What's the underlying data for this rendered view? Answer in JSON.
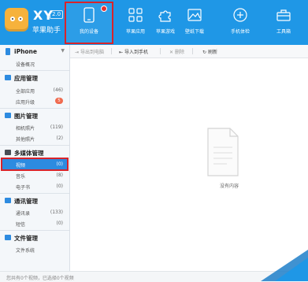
{
  "brand": {
    "logo_text": "XY",
    "version": "2.0",
    "subtitle": "苹果助手"
  },
  "nav": [
    {
      "label": "我的设备",
      "icon": "phone-icon",
      "active": true
    },
    {
      "label": "苹果应用",
      "icon": "apps-grid-icon"
    },
    {
      "label": "苹果游戏",
      "icon": "puzzle-icon"
    },
    {
      "label": "壁纸下载",
      "icon": "image-icon"
    },
    {
      "label": "手机体检",
      "icon": "plus-circle-icon"
    },
    {
      "label": "工具箱",
      "icon": "toolbox-icon"
    }
  ],
  "sidebar": {
    "device": {
      "label": "iPhone",
      "item_overview": "设备概况"
    },
    "apps": {
      "label": "应用管理",
      "all": "全部应用",
      "all_count": "(46)",
      "upgrade": "应用升级",
      "upgrade_badge": "5"
    },
    "photos": {
      "label": "图片管理",
      "camera": "相机照片",
      "camera_count": "(119)",
      "other": "其他照片",
      "other_count": "(2)"
    },
    "media": {
      "label": "多媒体管理",
      "video": "视频",
      "video_count": "(0)",
      "music": "音乐",
      "music_count": "(8)",
      "ebook": "电子书",
      "ebook_count": "(0)"
    },
    "comms": {
      "label": "通讯管理",
      "contacts": "通讯录",
      "contacts_count": "(133)",
      "sms": "短信",
      "sms_count": "(0)"
    },
    "files": {
      "label": "文件管理",
      "fs": "文件系统"
    }
  },
  "toolbar": {
    "export": "导出到电脑",
    "import": "导入到手机",
    "delete": "删除",
    "refresh": "刷新"
  },
  "content": {
    "empty_text": "没有内容"
  },
  "status": {
    "text": "您共有0个视频，已选择0个视频"
  },
  "colors": {
    "header": "#1f97e6",
    "highlight": "#d8232a",
    "selected": "#2d8be0"
  }
}
